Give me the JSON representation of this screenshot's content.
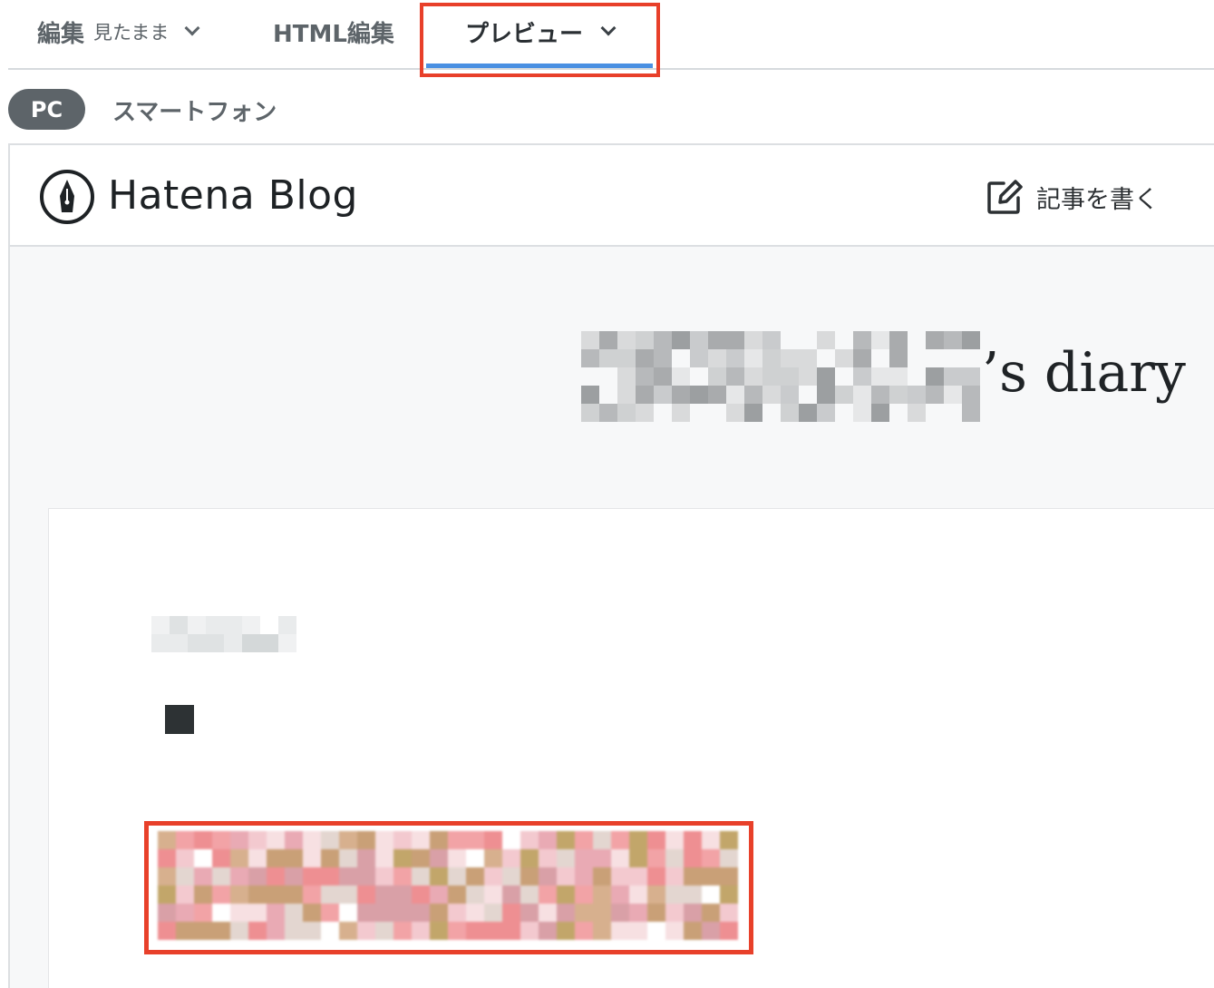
{
  "editor_tabs": {
    "visual_label": "編集",
    "visual_sub": "見たまま",
    "html_label": "HTML編集",
    "preview_label": "プレビュー"
  },
  "device_toggle": {
    "pc_label": "PC",
    "smartphone_label": "スマートフォン"
  },
  "blog_header": {
    "logo_text": "Hatena Blog",
    "write_button_label": "記事を書く"
  },
  "blog": {
    "title_suffix": "’s diary"
  },
  "colors": {
    "highlight": "#e8402a",
    "active_tab_underline": "#4a90e2",
    "pill_bg": "#5d6469"
  },
  "icons": {
    "logo": "hatena-pen-nib-icon",
    "write": "edit-pencil-icon",
    "tab_dropdown": "chevron-down-icon"
  }
}
